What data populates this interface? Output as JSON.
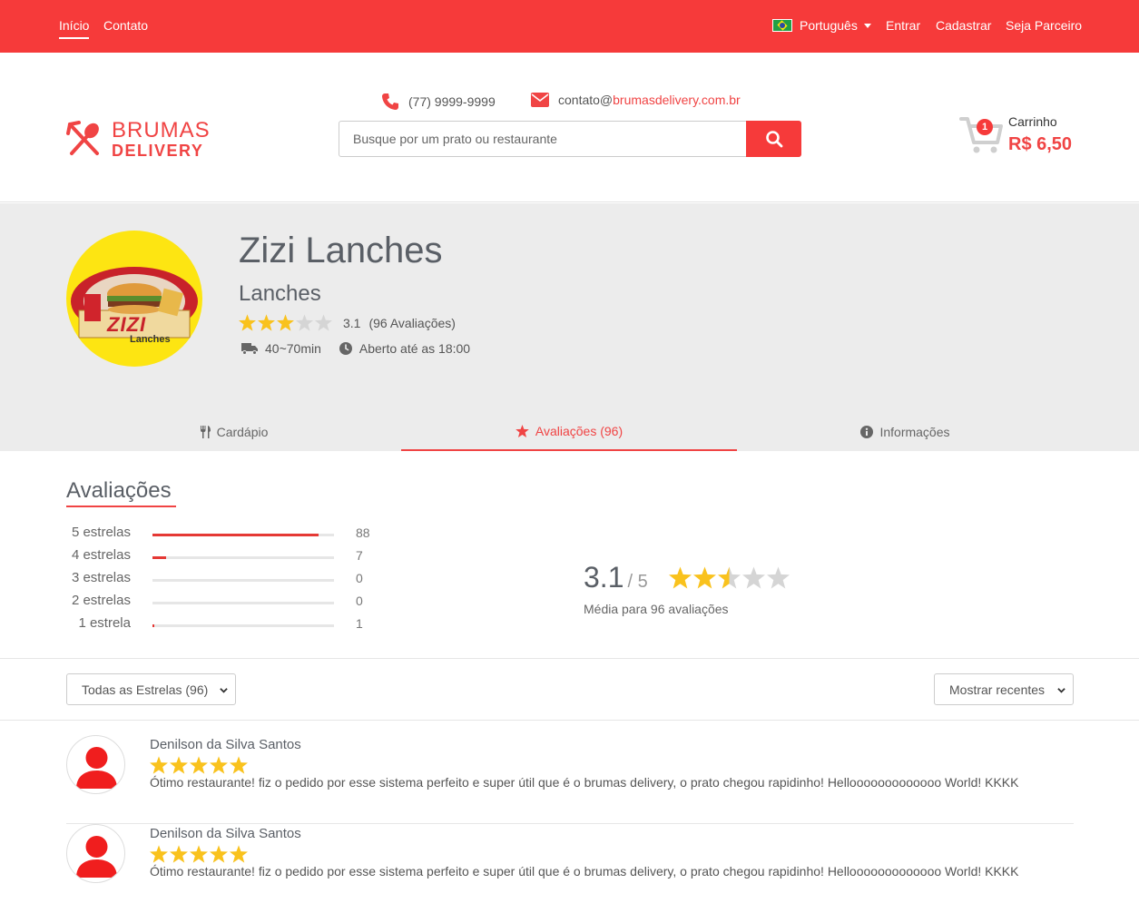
{
  "topbar": {
    "nav": [
      "Início",
      "Contato"
    ],
    "language": "Português",
    "login": "Entrar",
    "register": "Cadastrar",
    "partner": "Seja Parceiro"
  },
  "header": {
    "logo_line1": "BRUMAS",
    "logo_line2": "DELIVERY",
    "phone": "(77) 9999-9999",
    "email_prefix": "contato@",
    "email_domain": "brumasdelivery.com.br",
    "search_placeholder": "Busque por um prato ou restaurante",
    "cart_label": "Carrinho",
    "cart_count": "1",
    "cart_total": "R$ 6,50"
  },
  "restaurant": {
    "logo_text": "ZIZI",
    "logo_subtext": "Lanches",
    "name": "Zizi Lanches",
    "category": "Lanches",
    "rating": "3.1",
    "rating_count": "(96 Avaliações)",
    "delivery_time": "40~70min",
    "open_until": "Aberto até as 18:00",
    "stars_filled": 3
  },
  "tabs": {
    "menu": "Cardápio",
    "reviews": "Avaliações (96)",
    "info": "Informações"
  },
  "reviews_summary": {
    "title": "Avaliações",
    "rows": [
      {
        "label": "5 estrelas",
        "count": "88",
        "fraction": 0.917
      },
      {
        "label": "4 estrelas",
        "count": "7",
        "fraction": 0.073
      },
      {
        "label": "3 estrelas",
        "count": "0",
        "fraction": 0
      },
      {
        "label": "2 estrelas",
        "count": "0",
        "fraction": 0
      },
      {
        "label": "1 estrela",
        "count": "1",
        "fraction": 0.01
      }
    ],
    "average": "3.1",
    "average_max": "/ 5",
    "average_stars": 2.5,
    "caption": "Média para 96 avaliações"
  },
  "filters": {
    "stars_filter": "Todas as Estrelas (96)",
    "sort": "Mostrar recentes"
  },
  "colors": {
    "brand_red": "#f63a3a",
    "star_gold": "#f9c21d",
    "star_grey": "#d5d5d5"
  },
  "reviews": [
    {
      "name": "Denilson da Silva Santos",
      "stars": 5,
      "text": "Ótimo restaurante! fiz o pedido por esse sistema perfeito e super útil que é o brumas delivery, o prato chegou rapidinho! Hellooooooooooooo World! KKKK"
    },
    {
      "name": "Denilson da Silva Santos",
      "stars": 5,
      "text": "Ótimo restaurante! fiz o pedido por esse sistema perfeito e super útil que é o brumas delivery, o prato chegou rapidinho! Hellooooooooooooo World! KKKK"
    }
  ]
}
